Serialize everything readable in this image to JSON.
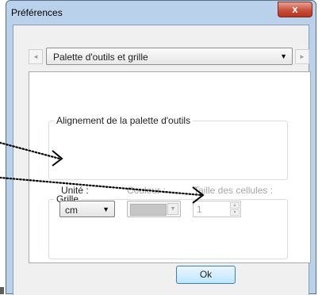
{
  "window": {
    "title": "Préférences",
    "close_glyph": "x"
  },
  "nav": {
    "prev_icon": "left-triangle-icon",
    "prev_glyph": "◄",
    "next_icon": "right-triangle-icon",
    "next_glyph": "►",
    "category": "Palette d'outils et grille",
    "dropdown_glyph": "▼"
  },
  "alignment_group": {
    "title": "Alignement de la palette d'outils"
  },
  "grid_group": {
    "title": "Grille",
    "unit_label": "Unité :",
    "unit_value": "cm",
    "color_label": "Couleur :",
    "color_value": "#c6c6c6",
    "cell_size_label": "Taille des cellules :",
    "cell_size_value": "1",
    "spin_up_glyph": "▲",
    "spin_down_glyph": "▼"
  },
  "footer": {
    "ok_label": "Ok"
  },
  "annotation": {
    "arrow_color": "#000000",
    "style": "dotted"
  }
}
